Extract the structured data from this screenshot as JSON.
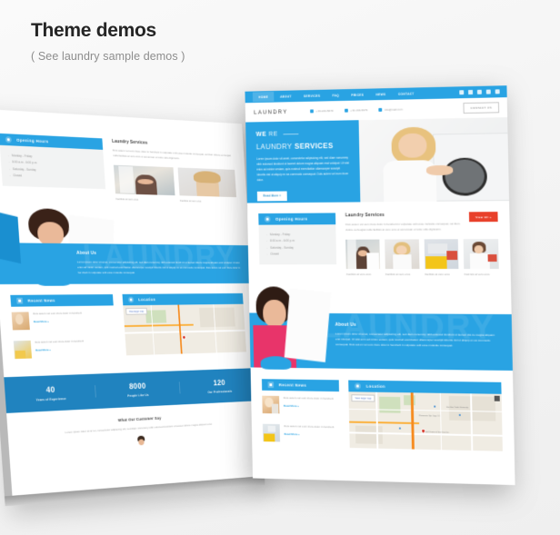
{
  "header": {
    "title": "Theme demos",
    "subtitle": "( See laundry sample demos )"
  },
  "colors": {
    "brand_blue": "#29a3e3",
    "stats_blue": "#2083bf",
    "accent_red": "#e8402a",
    "canvas": "#f2f2f2",
    "heading_text": "#252525",
    "body_text": "#a3a3a3"
  },
  "site": {
    "logo": "LAUNDRY",
    "nav": [
      {
        "label": "HOME",
        "active": true
      },
      {
        "label": "ABOUT",
        "active": false
      },
      {
        "label": "SERVICES",
        "active": false
      },
      {
        "label": "FAQ",
        "active": false
      },
      {
        "label": "PRICES",
        "active": false
      },
      {
        "label": "NEWS",
        "active": false
      },
      {
        "label": "CONTACT",
        "active": false
      }
    ],
    "socials": [
      "facebook-icon",
      "instagram-icon",
      "google-plus-icon",
      "twitter-icon",
      "rss-icon"
    ],
    "contacts": [
      {
        "icon": "phone-icon",
        "text": "+ 84-234-5678"
      },
      {
        "icon": "fax-icon",
        "text": "+ 84-234-5679"
      },
      {
        "icon": "email-icon",
        "text": "info@mail.com"
      }
    ],
    "contact_button": "CONTACT US",
    "hero": {
      "line1_strong": "WE",
      "line1_light": "RE",
      "line2_light": "LAUNDRY",
      "line2_strong": "SERVICES",
      "body": "Lorem ipsum dolor sit amet, consectetur adipisicing elit, sed diam nonummy nibh euismod tincidunt ut laoreet dolore magna aliquam erat volutpat. Ut wisi enim ad minim veniam, quis nostrud exercitation ullamcorper suscipit lobortis nisl ut aliquip ex ea commodo consequat. Duis autem vel eum iriure dolor.",
      "button": "Read More »"
    },
    "opening_hours": {
      "title": "Opening Hours",
      "icon": "clock-icon",
      "rows": [
        "Monday - Friday",
        "8:00 a.m - 6:00 p.m",
        "Saturday - Sunday",
        "Closed"
      ]
    },
    "services": {
      "title": "Laundry Services",
      "body": "Duis autem vel eum iriure dolor in hendrerit in vulputate velit esse molestie consequat, vel illum dolore eu feugiat nulla facilisis at vero eros et accumsan et iusto odio dignissim.",
      "view_all": "View All »",
      "items": [
        {
          "caption": "Facilisis at vero eros"
        },
        {
          "caption": "Facilisis at vero eros"
        },
        {
          "caption": "Facilisis at vero eros"
        },
        {
          "caption": "Facilisis at vero eros"
        }
      ]
    },
    "about": {
      "title": "About Us",
      "watermark": "LAUNDRY",
      "body": "Lorem ipsum dolor sit amet, consectetur adipisicing elit, sed diam nonummy nibh euismod tincidunt ut laoreet dolore magna aliquam erat volutpat. Ut wisi enim ad minim veniam, quis nostrud exercitation ullamcorper suscipit lobortis nisl ut aliquip ex ea commodo consequat. Duis autem vel eum iriure dolor in hendrerit in vulputate velit esse molestie consequat."
    },
    "recent_news": {
      "title": "Recent News",
      "icon": "newspaper-icon",
      "items": [
        {
          "text": "Duis autem vel eum iriure dolor in hendrerit",
          "link": "Read More »"
        },
        {
          "text": "Duis autem vel eum iriure dolor in hendrerit",
          "link": "Read More »"
        }
      ]
    },
    "location": {
      "title": "Location",
      "icon": "map-pin-icon",
      "map_button": "View larger map",
      "labels": [
        "Van Hoa Trade University",
        "Pharmacie Dpt. Sept. 12",
        "The Tech Museum of Innovation",
        "Adobe Systems Inc. Almaden Center",
        "Self Center at San Jose Inc.",
        "San Jose Museum",
        "San Jose Convention Center",
        "Callean - Direct"
      ]
    },
    "stats": [
      {
        "number": "40",
        "label": "Years of Experience"
      },
      {
        "number": "8000",
        "label": "People Like Us"
      },
      {
        "number": "120",
        "label": "Our Professionals"
      }
    ],
    "testimonials": {
      "title": "What Our Customer Say",
      "body": "Lorem ipsum dolor sit amet, consectetur adipiscing elit, sed diam nonummy nibh euismod tincidunt ut laoreet dolore magna aliquam erat"
    }
  }
}
